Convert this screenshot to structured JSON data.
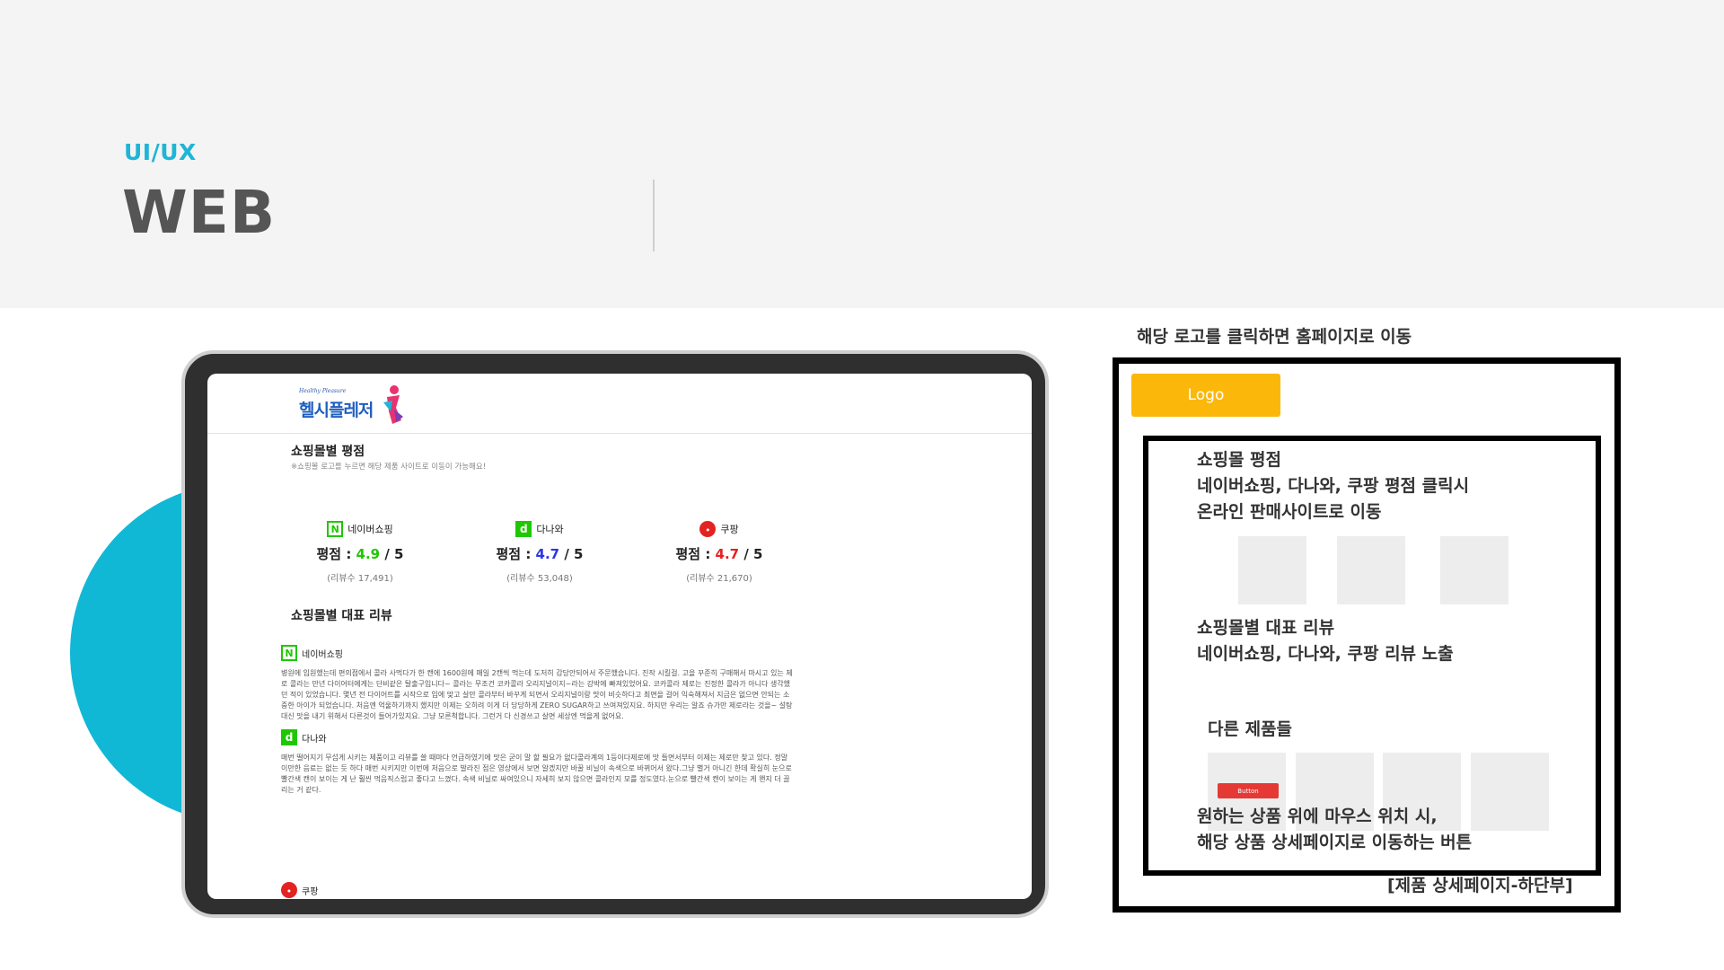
{
  "slide": {
    "category": "UI/UX",
    "title": "WEB"
  },
  "tablet": {
    "logo_small": "Healthy Pleasure",
    "logo_main": "헬시플레저",
    "ratings_title": "쇼핑몰별 평점",
    "ratings_note": "※쇼핑몰 로고를 누르면 해당 제품 사이트로 이동이 가능해요!",
    "malls": [
      {
        "name": "네이버쇼핑",
        "label": "평점 : ",
        "score": "4.9",
        "suffix": " / 5",
        "reviews": "(리뷰수 17,491)",
        "score_color": "#1ec800"
      },
      {
        "name": "다나와",
        "label": "평점 : ",
        "score": "4.7",
        "suffix": " / 5",
        "reviews": "(리뷰수 53,048)",
        "score_color": "#2b36e8"
      },
      {
        "name": "쿠팡",
        "label": "평점 : ",
        "score": "4.7",
        "suffix": " / 5",
        "reviews": "(리뷰수 21,670)",
        "score_color": "#e32322"
      }
    ],
    "reviews_title": "쇼핑몰별 대표 리뷰",
    "reviews": [
      {
        "mall": "네이버쇼핑",
        "text": "병원에 입원했는데 편의점에서 콜라 사먹다가 한 캔에 1600원에 매일 2캔씩 먹는데 도저히 감당안되어서 주문했습니다. 진작 시킬걸. 고을 꾸준히 구매해서 마시고 있는 제로 콜라는 만년 다이어터에게는 단비같은 탈출구입니다~ 콜라는 무조건 코카콜라 오리지널이지~라는 강박에 빠져있었어요. 코카콜라 제로는 진정한 콜라가 아니다 생각했던 적이 있었습니다. 몇년 전 다이어트를 시작으로 입에 맞고 살만 콜라부터 바꾸게 되면서 오리지널이랑 맛이 비슷하다고 최면을 걸어 익숙해져서 지금은 없으면 안되는 소중한 아이가 되었습니다. 처음엔 억울하기까지 했지만 이제는 오히려 이게 더 당당하게 ZERO SUGAR하고 쓰여져있지요. 하지만 우리는 알죠 슈가만 제로라는 것을~ 설탕 대신 맛을 내기 위해서 다른것이 들어가있지요. 그냥 모른척합니다. 그런거 다 신경쓰고 살면 세상엔 먹을게 없어요."
      },
      {
        "mall": "다나와",
        "text": "매번 떨어지기 무섭게 시키는 제품이고 리뷰를 쓸 때마다 언급하였기에 맛은 굳이 말 할 필요가 없다콜라계의 1등이다제로에 맛 들면서부터 이제는 제로만 찾고 있다. 정말 이만한 음료는 없는 듯 하다 매번 시키지만 이번에 처음으로 발라진 점은 영상에서 보면 알겠지만 바꿀 비닐이 속색으로 바뀌어서 왔다.그냥 별거 아니긴 한데 확실히 눈으로 빨간색 캔이 보이는 게 난 훨씬 먹음직스럽고 좋다고 느꼈다. 속색 비닐로 싸여있으니 자세히 보지 않으면 콜라인지 모를 정도였다.눈으로 빨간색 캔이 보이는 게 왠지 더 끌리는 거 같다."
      },
      {
        "mall": "쿠팡",
        "text": ""
      }
    ]
  },
  "wireframe": {
    "top_note": "해당 로고를 클릭하면 홈페이지로 이동",
    "logo_label": "Logo",
    "ratings_lines": [
      "쇼핑몰 평점",
      "네이버쇼핑, 다나와, 쿠팡 평점 클릭시",
      "온라인 판매사이트로 이동"
    ],
    "reviews_lines": [
      "쇼핑몰별 대표 리뷰",
      "네이버쇼핑, 다나와, 쿠팡 리뷰 노출"
    ],
    "others_title": "다른 제품들",
    "button_label": "Button",
    "hover_lines": [
      "원하는 상품 위에 마우스 위치 시,",
      "해당 상품 상세페이지로 이동하는 버튼"
    ],
    "caption": "[제품 상세페이지-하단부]"
  },
  "colors": {
    "accent": "#1fb5d6",
    "circle": "#10b8d6",
    "logo_button": "#fbb80b",
    "red_button": "#e53935"
  }
}
